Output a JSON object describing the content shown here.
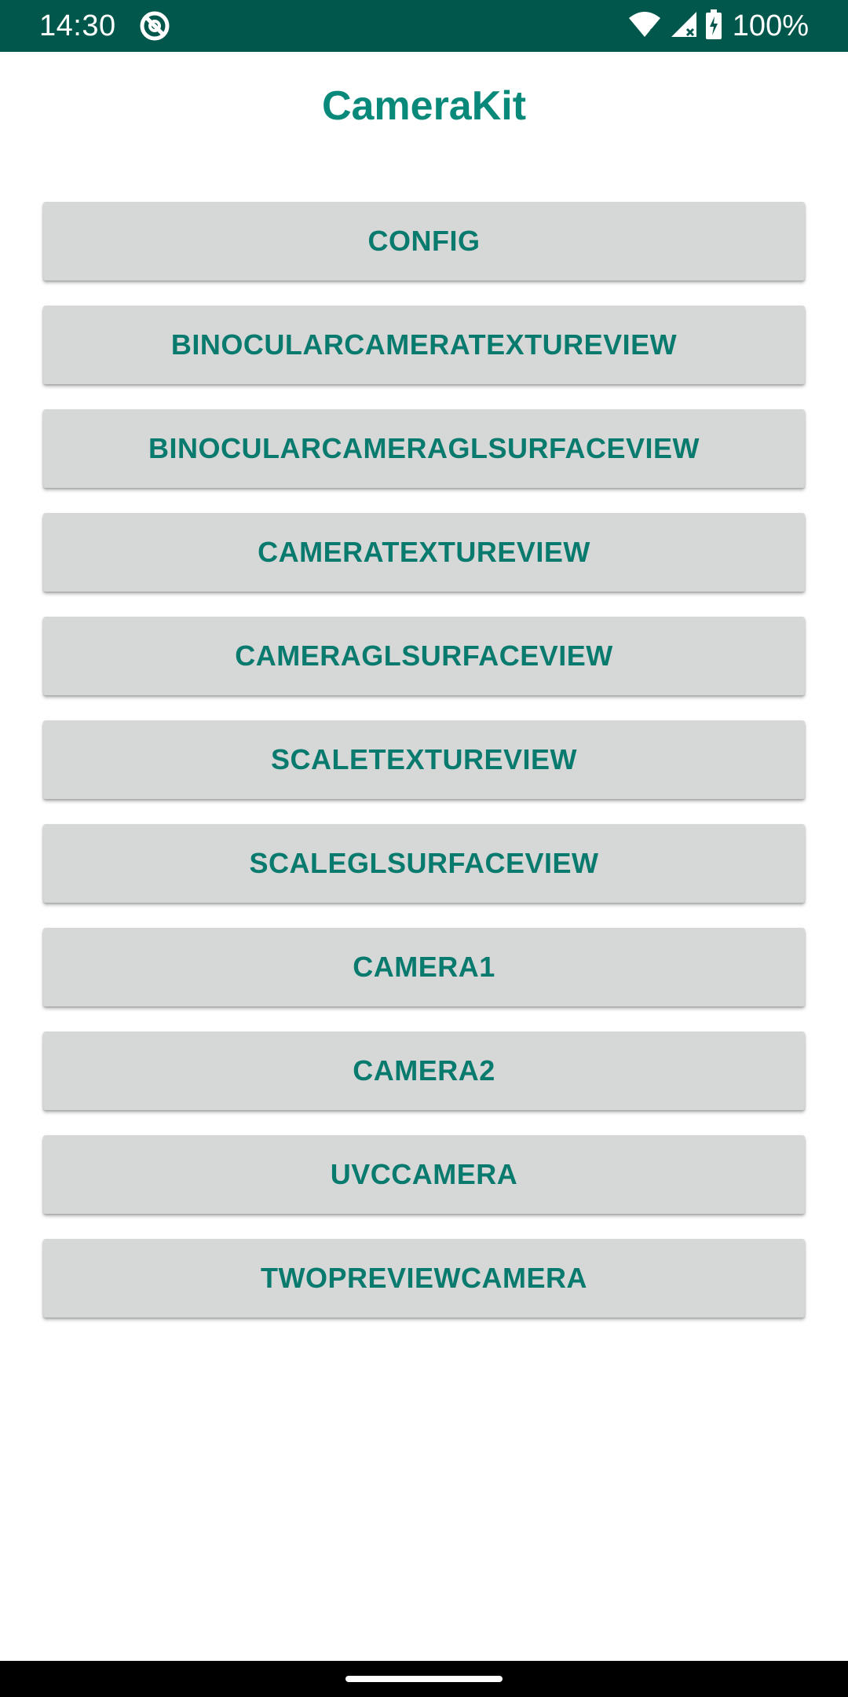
{
  "status_bar": {
    "time": "14:30",
    "battery_text": "100%",
    "icons": [
      "app-notification-icon",
      "wifi-icon",
      "signal-icon",
      "battery-charging-icon"
    ],
    "color": "#01574b"
  },
  "app": {
    "title": "CameraKit",
    "accent_color": "#09897a"
  },
  "buttons": [
    {
      "label": "CONFIG"
    },
    {
      "label": "BINOCULARCAMERATEXTUREVIEW"
    },
    {
      "label": "BINOCULARCAMERAGLSURFACEVIEW"
    },
    {
      "label": "CAMERATEXTUREVIEW"
    },
    {
      "label": "CAMERAGLSURFACEVIEW"
    },
    {
      "label": "SCALETEXTUREVIEW"
    },
    {
      "label": "SCALEGLSURFACEVIEW"
    },
    {
      "label": "CAMERA1"
    },
    {
      "label": "CAMERA2"
    },
    {
      "label": "UVCCAMERA"
    },
    {
      "label": "TWOPREVIEWCAMERA"
    }
  ]
}
